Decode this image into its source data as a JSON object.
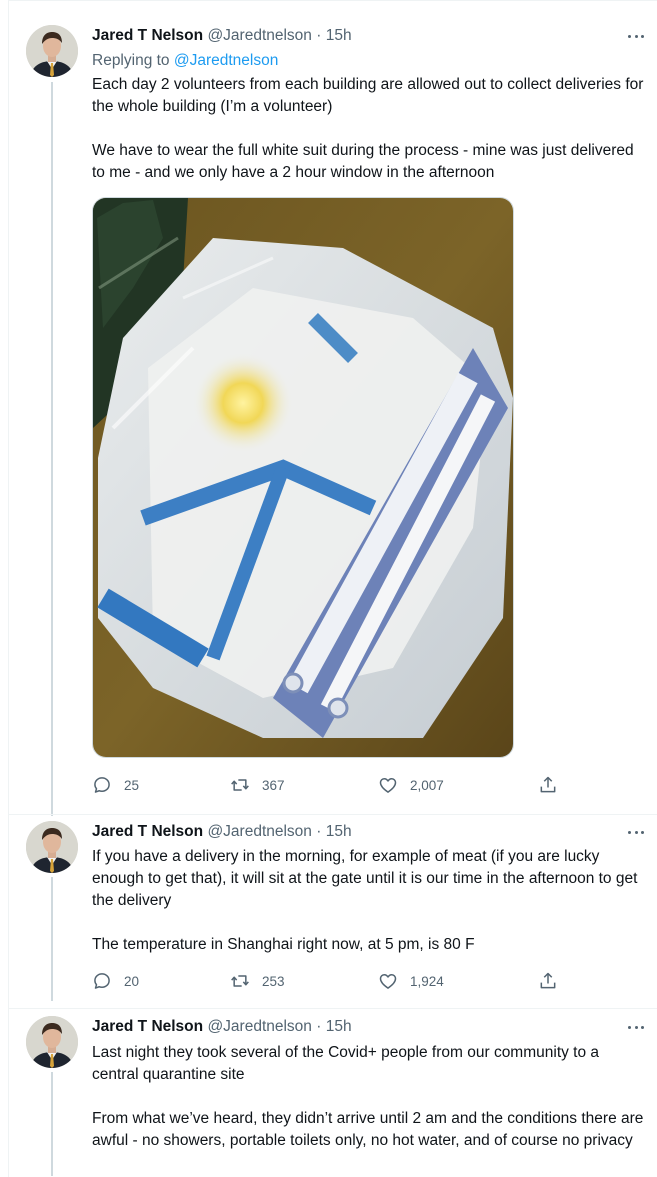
{
  "tweets": [
    {
      "name": "Jared T Nelson",
      "handle": "@Jaredtnelson",
      "dot": "·",
      "time": "15h",
      "reply_prefix": "Replying to",
      "reply_to": "@Jaredtnelson",
      "text": "Each day 2 volunteers from each building are allowed out to collect deliveries for the whole building (I’m a volunteer)\n\nWe have to wear the full white suit during the process - mine was just delivered to me - and we only have a 2 hour window in the afternoon",
      "stats": {
        "replies": "25",
        "retweets": "367",
        "likes": "2,007"
      }
    },
    {
      "name": "Jared T Nelson",
      "handle": "@Jaredtnelson",
      "dot": "·",
      "time": "15h",
      "text": "If you have a delivery in the morning, for example of meat (if you are lucky enough to get that), it will sit at the gate until it is our time in the afternoon to get the delivery\n\nThe temperature in Shanghai right now, at 5 pm, is 80 F",
      "stats": {
        "replies": "20",
        "retweets": "253",
        "likes": "1,924"
      }
    },
    {
      "name": "Jared T Nelson",
      "handle": "@Jaredtnelson",
      "dot": "·",
      "time": "15h",
      "text": "Last night they took several of the Covid+ people from our community to a central quarantine site\n\nFrom what we’ve heard, they didn’t arrive until 2 am and the conditions there are awful - no showers, portable toilets only, no hot water, and of course no privacy"
    }
  ],
  "icons": {
    "reply": "speech-bubble-icon",
    "retweet": "retweet-icon",
    "like": "heart-icon",
    "share": "share-icon",
    "more": "more-dots-icon"
  },
  "colors": {
    "accent": "#1d9bf0",
    "secondary_text": "#536471",
    "thread_line": "#cfd9de"
  }
}
